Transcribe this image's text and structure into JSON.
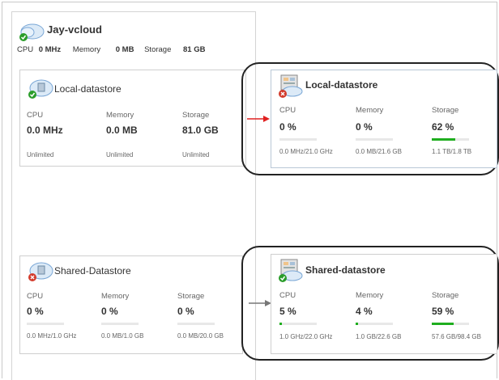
{
  "vcloud": {
    "title": "Jay-vcloud",
    "cpu_label": "CPU",
    "cpu_value": "0 MHz",
    "memory_label": "Memory",
    "memory_value": "0 MB",
    "storage_label": "Storage",
    "storage_value": "81 GB"
  },
  "left_cards": [
    {
      "title": "Local-datastore",
      "cpu_label": "CPU",
      "cpu_value": "0.0 MHz",
      "cpu_sub": "Unlimited",
      "memory_label": "Memory",
      "memory_value": "0.0 MB",
      "memory_sub": "Unlimited",
      "storage_label": "Storage",
      "storage_value": "81.0 GB",
      "storage_sub": "Unlimited"
    },
    {
      "title": "Shared-Datastore",
      "cpu_label": "CPU",
      "cpu_value": "0 %",
      "cpu_sub": "0.0 MHz/1.0 GHz",
      "memory_label": "Memory",
      "memory_value": "0 %",
      "memory_sub": "0.0 MB/1.0 GB",
      "storage_label": "Storage",
      "storage_value": "0 %",
      "storage_sub": "0.0 MB/20.0 GB"
    }
  ],
  "right_cards": [
    {
      "title": "Local-datastore",
      "cpu_label": "CPU",
      "cpu_value": "0 %",
      "cpu_sub": "0.0 MHz/21.0 GHz",
      "cpu_pct": 0,
      "memory_label": "Memory",
      "memory_value": "0 %",
      "memory_sub": "0.0 MB/21.6 GB",
      "memory_pct": 0,
      "storage_label": "Storage",
      "storage_value": "62 %",
      "storage_sub": "1.1 TB/1.8 TB",
      "storage_pct": 62
    },
    {
      "title": "Shared-datastore",
      "cpu_label": "CPU",
      "cpu_value": "5 %",
      "cpu_sub": "1.0 GHz/22.0 GHz",
      "cpu_pct": 5,
      "memory_label": "Memory",
      "memory_value": "4 %",
      "memory_sub": "1.0 GB/22.6 GB",
      "memory_pct": 4,
      "storage_label": "Storage",
      "storage_value": "59 %",
      "storage_sub": "57.6 GB/98.4 GB",
      "storage_pct": 59
    }
  ],
  "colors": {
    "bar_fill": "#1fae1f",
    "arrow_top": "#e02020",
    "arrow_bottom": "#777777",
    "status_ok": "#2a9d2a",
    "status_error": "#d33b2c"
  },
  "icons": [
    "cloud-datastore-icon",
    "status-ok-icon",
    "status-error-icon",
    "datastore-server-icon",
    "arrow-right-icon"
  ]
}
